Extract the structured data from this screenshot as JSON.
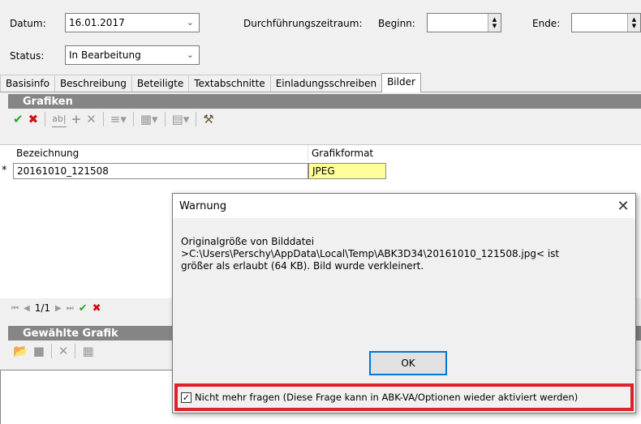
{
  "header": {
    "datum_label": "Datum:",
    "datum_value": "16.01.2017",
    "zeitraum_label": "Durchführungszeitraum:",
    "beginn_label": "Beginn:",
    "ende_label": "Ende:",
    "status_label": "Status:",
    "status_value": "In Bearbeitung"
  },
  "tabs": [
    "Basisinfo",
    "Beschreibung",
    "Beteiligte",
    "Textabschnitte",
    "Einladungsschreiben",
    "Bilder"
  ],
  "active_tab": "Bilder",
  "grafiken": {
    "title": "Grafiken",
    "col_bezeichnung": "Bezeichnung",
    "col_format": "Grafikformat",
    "row_marker": "*",
    "row_name": "20161010_121508",
    "row_format": "JPEG",
    "nav_position": "1/1"
  },
  "gewaehlte": {
    "title": "Gewählte Grafik"
  },
  "dialog": {
    "title": "Warnung",
    "message_line1": "Originalgröße von Bilddatei",
    "message_line2": ">C:\\Users\\Perschy\\AppData\\Local\\Temp\\ABK3D34\\20161010_121508.jpg< ist",
    "message_line3": "größer als erlaubt (64 KB). Bild wurde verkleinert.",
    "ok_label": "OK",
    "checkbox_label": "Nicht mehr fragen (Diese Frage kann in ABK-VA/Optionen wieder aktiviert werden)"
  },
  "colors": {
    "section_header": "#858585",
    "format_cell": "#ffff99",
    "highlight": "#e0202a",
    "ok_border": "#0078d7"
  }
}
